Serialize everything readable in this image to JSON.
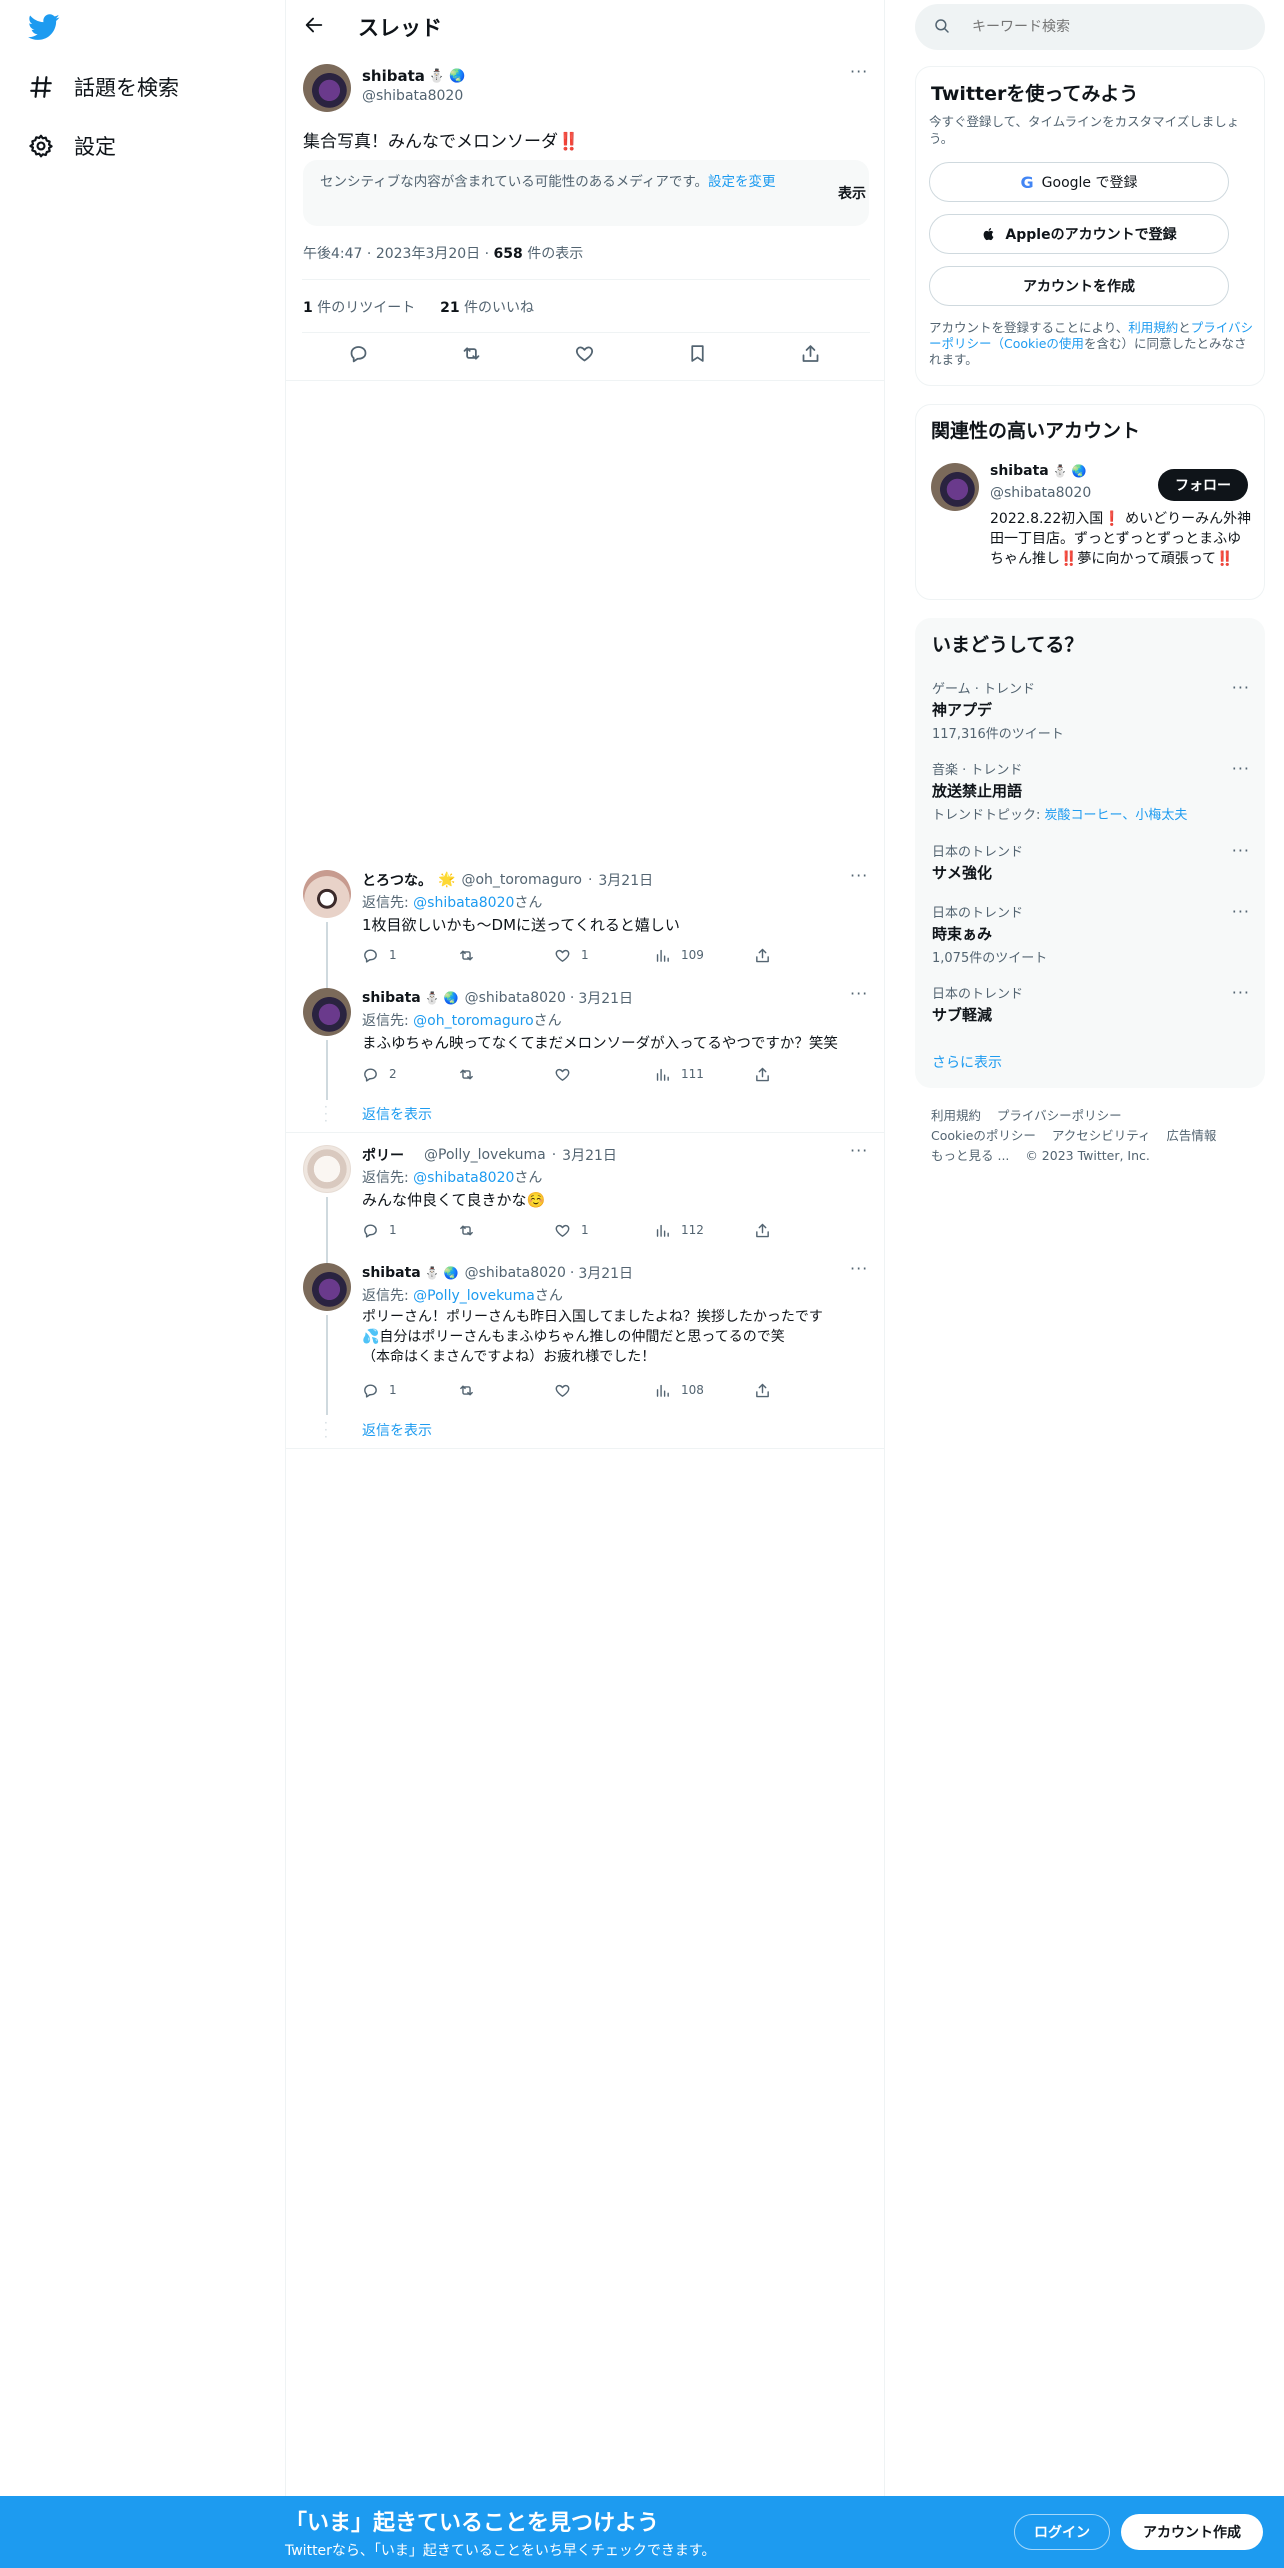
{
  "nav": {
    "explore_label": "話題を検索",
    "settings_label": "設定"
  },
  "header": {
    "title": "スレッド"
  },
  "tweet": {
    "author_name": "shibata",
    "author_handle": "@shibata8020",
    "text": "集合写真！みんなでメロンソーダ‼️",
    "sensitive_notice": "センシティブな内容が含まれている可能性のあるメディアです。",
    "sensitive_settings_link": "設定を変更",
    "show_label": "表示",
    "time": "午後4:47",
    "date": "2023年3月20日",
    "views_count": "658",
    "views_label": "件の表示",
    "retweets_count": "1",
    "retweets_label": "件のリツイート",
    "likes_count": "21",
    "likes_label": "件のいいね"
  },
  "replies": [
    {
      "name": "とろつな。",
      "badge": "🌟",
      "handle": "@oh_toromaguro",
      "date": "3月21日",
      "reply_to_prefix": "返信先: ",
      "reply_to": "@shibata8020",
      "reply_to_suffix": "さん",
      "text": "1枚目欲しいかも〜DMに送ってくれると嬉しい",
      "replies": "1",
      "retweets": "",
      "likes": "1",
      "views": "109"
    },
    {
      "name": "shibata",
      "handle": "@shibata8020",
      "date": "3月21日",
      "reply_to_prefix": "返信先: ",
      "reply_to": "@oh_toromaguro",
      "reply_to_suffix": "さん",
      "text": "まふゆちゃん映ってなくてまだメロンソーダが入ってるやつですか？笑笑",
      "replies": "2",
      "retweets": "",
      "likes": "",
      "views": "111"
    },
    {
      "name": "ポリー",
      "handle": "@Polly_lovekuma",
      "date": "3月21日",
      "reply_to_prefix": "返信先: ",
      "reply_to": "@shibata8020",
      "reply_to_suffix": "さん",
      "text": "みんな仲良くて良きかな☺️",
      "replies": "1",
      "retweets": "",
      "likes": "1",
      "views": "112"
    },
    {
      "name": "shibata",
      "handle": "@shibata8020",
      "date": "3月21日",
      "reply_to_prefix": "返信先: ",
      "reply_to": "@Polly_lovekuma",
      "reply_to_suffix": "さん",
      "text_line1": "ポリーさん！ポリーさんも昨日入国してましたよね？挨拶したかったです",
      "text_line2": "💦自分はポリーさんもまふゆちゃん推しの仲間だと思ってるので笑",
      "text_line3": "（本命はくまさんですよね）お疲れ様でした！",
      "replies": "1",
      "retweets": "",
      "likes": "",
      "views": "108"
    }
  ],
  "show_replies_label": "返信を表示",
  "search": {
    "placeholder": "キーワード検索"
  },
  "signup": {
    "title": "Twitterを使ってみよう",
    "subtitle": "今すぐ登録して、タイムラインをカスタマイズしましょう。",
    "google_label": "Google で登録",
    "apple_label": "Appleのアカウントで登録",
    "create_label": "アカウントを作成",
    "legal_prefix": "アカウントを登録することにより、",
    "legal_terms": "利用規約",
    "legal_and": "と",
    "legal_privacy": "プライバシーポリシー（Cookieの使用",
    "legal_suffix": "を含む）に同意したとみなされます。"
  },
  "related": {
    "title": "関連性の高いアカウント",
    "name": "shibata",
    "handle": "@shibata8020",
    "follow_label": "フォロー",
    "bio": "2022.8.22初入国❗️ めいどりーみん外神田一丁目店。ずっとずっとずっとまふゆちゃん推し‼️夢に向かって頑張って‼️"
  },
  "trends": {
    "title": "いまどうしてる？",
    "items": [
      {
        "category": "ゲーム · トレンド",
        "name": "神アプデ",
        "sub": "117,316件のツイート"
      },
      {
        "category": "音楽 · トレンド",
        "name": "放送禁止用語",
        "sub_prefix": "トレンドトピック: ",
        "sub_links": "炭酸コーヒー、小梅太夫"
      },
      {
        "category": "日本のトレンド",
        "name": "サメ強化"
      },
      {
        "category": "日本のトレンド",
        "name": "時束ぁみ",
        "sub": "1,075件のツイート"
      },
      {
        "category": "日本のトレンド",
        "name": "サブ軽減"
      }
    ],
    "show_more": "さらに表示"
  },
  "footer": {
    "terms": "利用規約",
    "privacy": "プライバシーポリシー",
    "cookie": "Cookieのポリシー",
    "accessibility": "アクセシビリティ",
    "ads": "広告情報",
    "more": "もっと見る ...",
    "copyright": "© 2023 Twitter, Inc."
  },
  "bottom_bar": {
    "title": "「いま」起きていることを見つけよう",
    "subtitle": "Twitterなら、「いま」起きていることをいち早くチェックできます。",
    "login_label": "ログイン",
    "signup_label": "アカウント作成"
  },
  "colors": {
    "accent": "#1d9bf0",
    "text": "#0f1419",
    "muted": "#536471",
    "border": "#eff3f4"
  }
}
